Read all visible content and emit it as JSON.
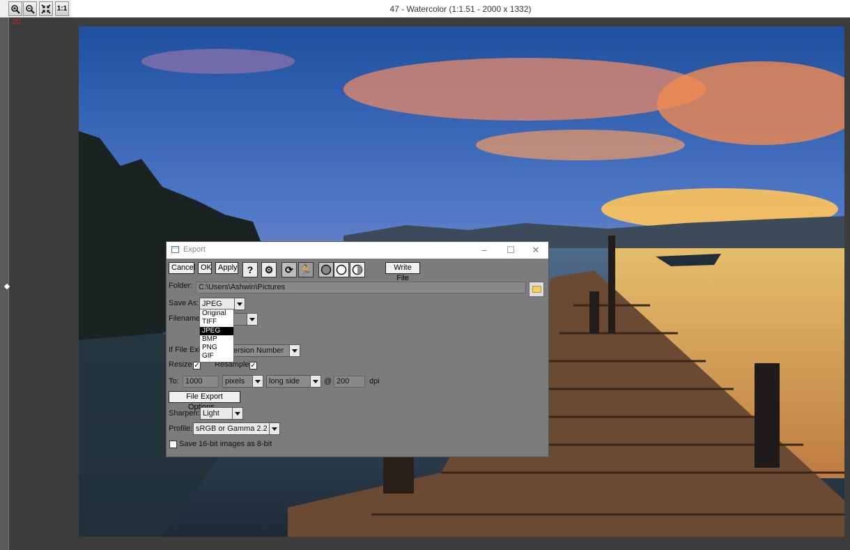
{
  "window": {
    "title": "47 - Watercolor (1:1.51 - 2000 x 1332)",
    "indicator": "2D"
  },
  "zoom_buttons": [
    {
      "label": "",
      "icon": "zoom-in-icon"
    },
    {
      "label": "",
      "icon": "zoom-out-icon"
    },
    {
      "label": "",
      "icon": "fit-screen-icon"
    },
    {
      "label": "1:1",
      "icon": ""
    }
  ],
  "dialog": {
    "title": "Export",
    "buttons": {
      "cancel": "Cancel",
      "ok": "OK",
      "apply": "Apply",
      "write_file": "Write File"
    },
    "folder": {
      "label": "Folder:",
      "value": "C:\\Users\\Ashwin\\Pictures"
    },
    "save_as": {
      "label": "Save As:",
      "value": "JPEG",
      "options": [
        "Original",
        "TIFF",
        "JPEG",
        "BMP",
        "PNG",
        "GIF"
      ]
    },
    "filename": {
      "label": "Filename:"
    },
    "if_file_exists": {
      "label": "If File Exis",
      "value": "ersion Number"
    },
    "resize": {
      "label": "Resize",
      "checked": true
    },
    "resample": {
      "label": "Resample",
      "checked": true
    },
    "to": {
      "label": "To:",
      "size": "1000",
      "unit": "pixels",
      "side": "long side",
      "at": "@",
      "dpi": "200",
      "dpi_label": "dpi"
    },
    "file_export_options": "File Export Options...",
    "sharpen": {
      "label": "Sharpen:",
      "value": "Light"
    },
    "profile": {
      "label": "Profile:",
      "value": "sRGB or Gamma 2.2"
    },
    "save16": {
      "label": "Save 16-bit images as 8-bit",
      "checked": false
    }
  }
}
